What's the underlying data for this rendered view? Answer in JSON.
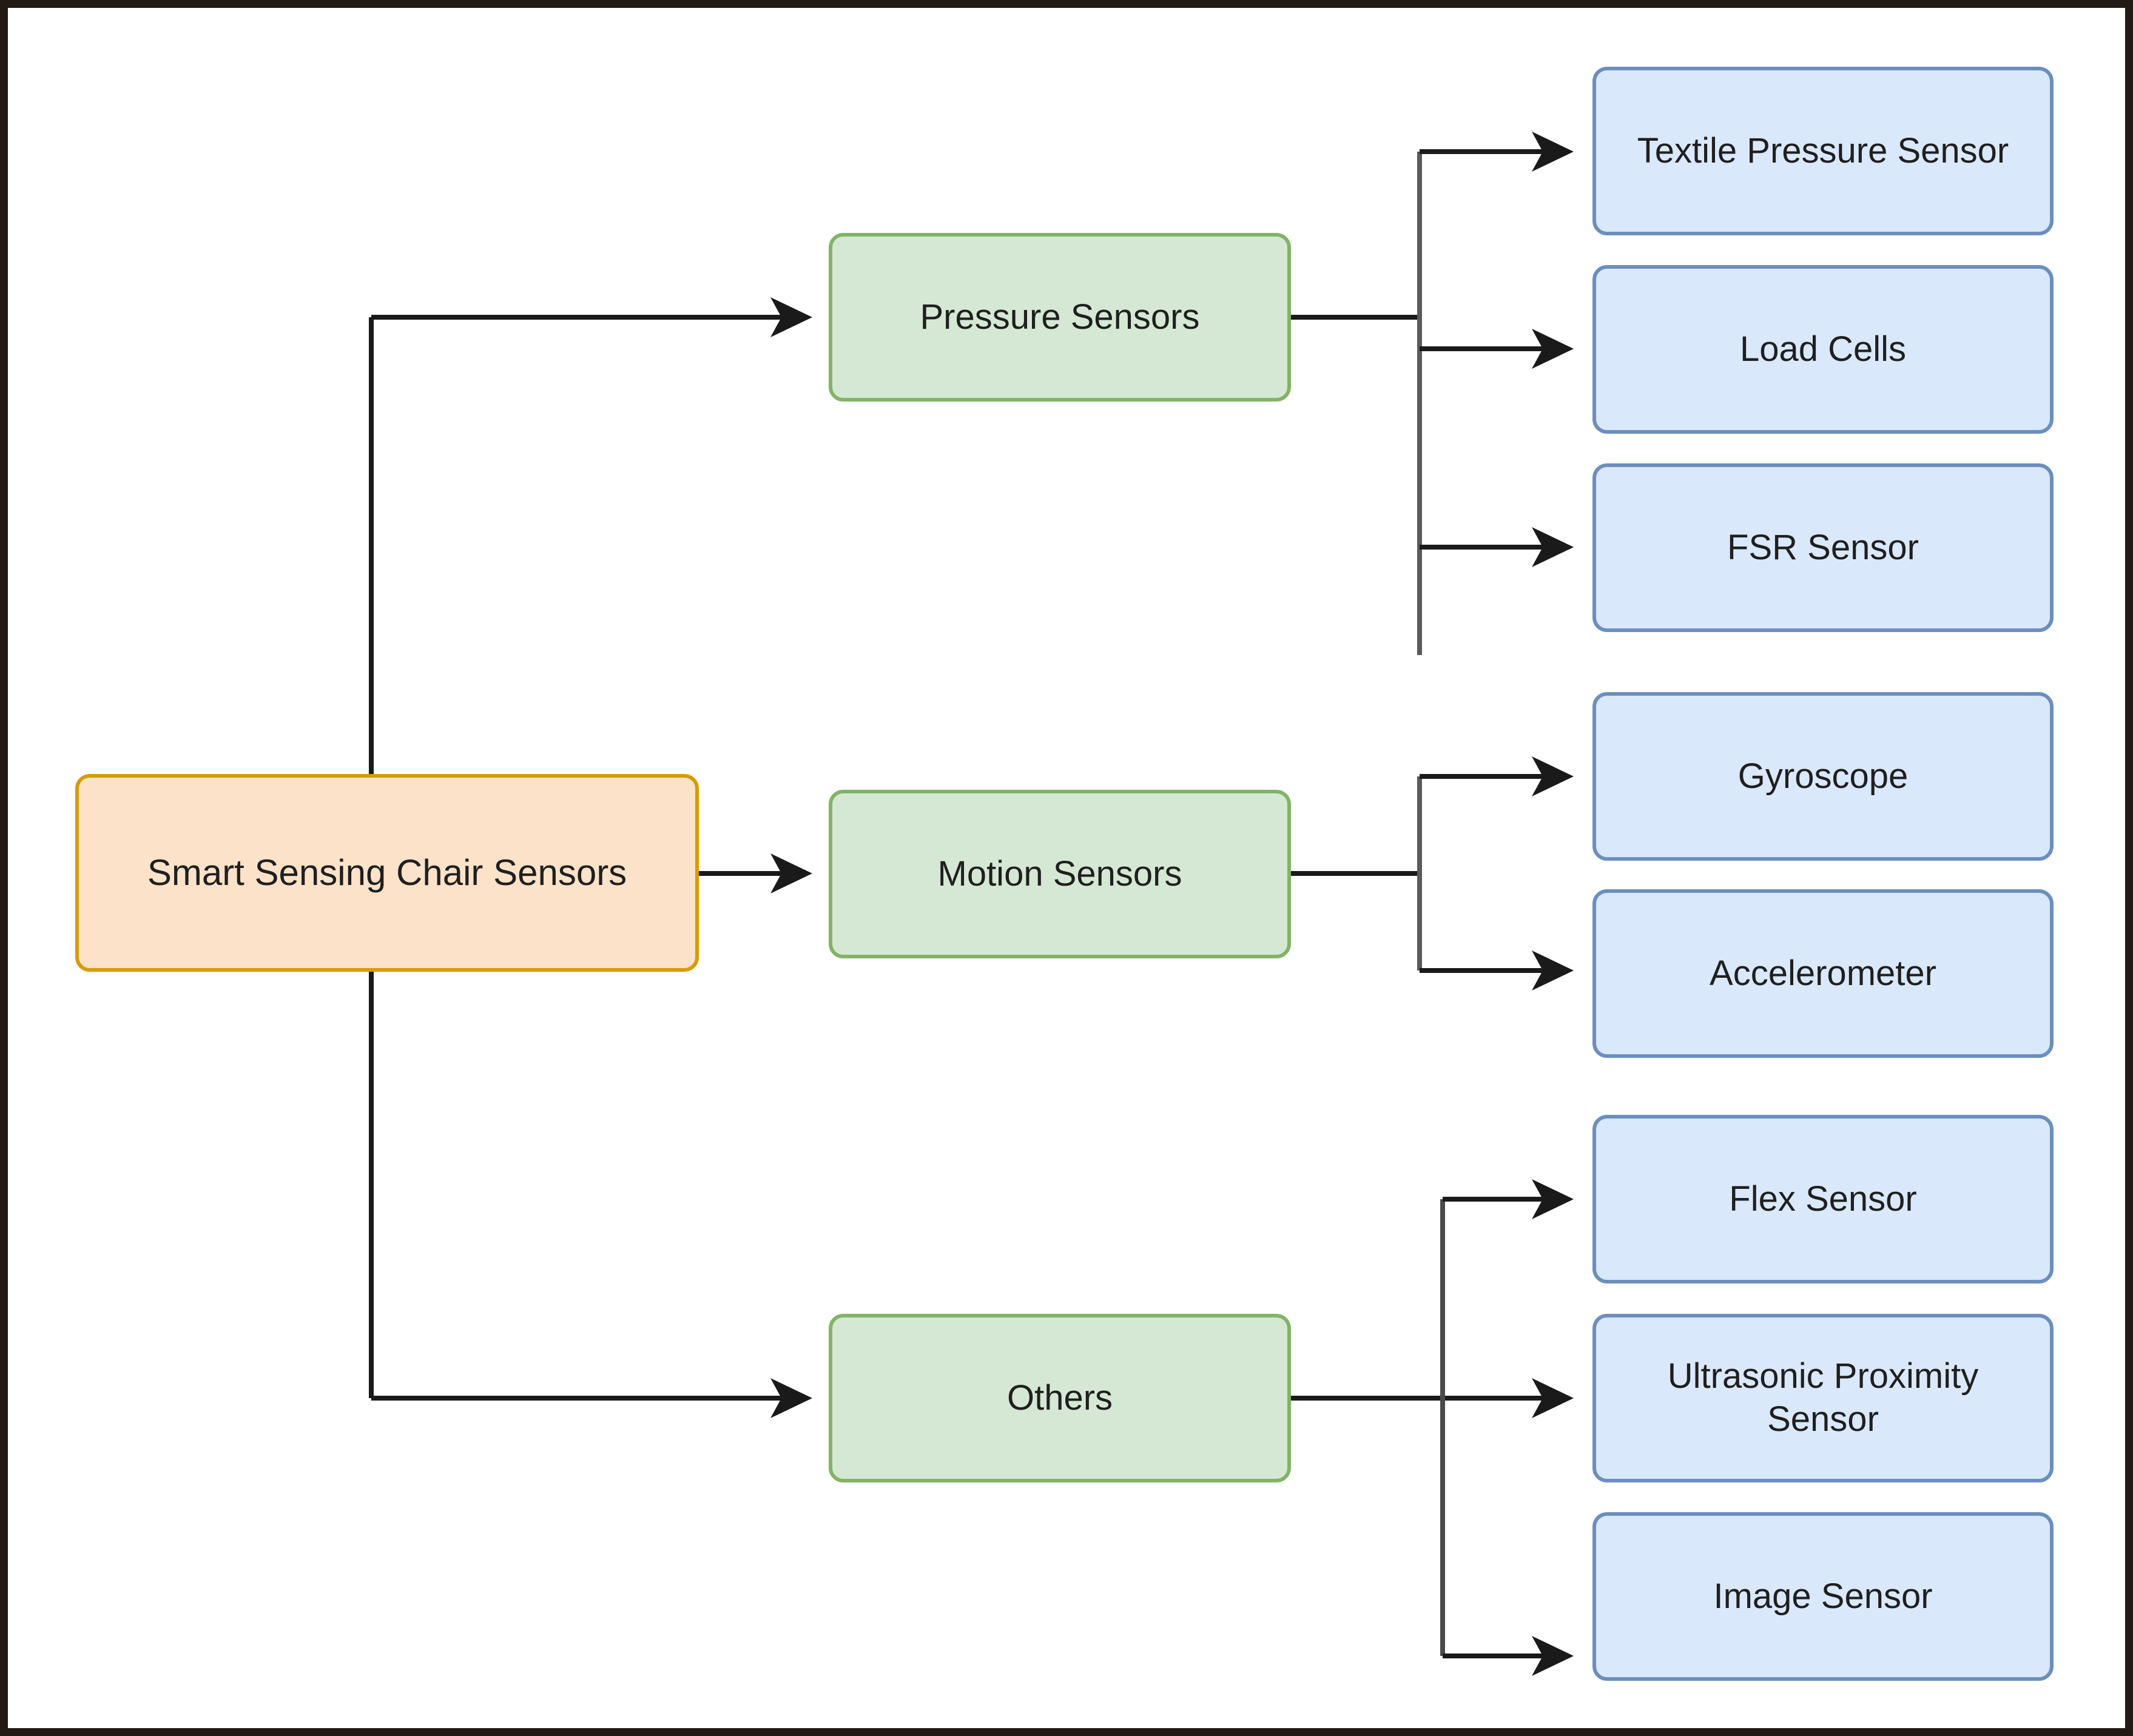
{
  "diagram": {
    "title": "Smart Sensing Chair Sensors taxonomy",
    "type": "tree",
    "orientation": "left-to-right",
    "colors": {
      "root_fill": "#fbe2c8",
      "root_stroke": "#d79b00",
      "category_fill": "#d5e8d4",
      "category_stroke": "#82b366",
      "leaf_fill": "#dae8fc",
      "leaf_stroke": "#6c8ebf",
      "edge": "#1a1a1a",
      "frame": "#231a15",
      "background": "#ffffff"
    }
  },
  "root": {
    "label": "Smart Sensing Chair Sensors"
  },
  "categories": [
    {
      "label": "Pressure Sensors",
      "children": [
        {
          "label": "Textile Pressure Sensor"
        },
        {
          "label": "Load Cells"
        },
        {
          "label": "FSR Sensor"
        }
      ]
    },
    {
      "label": "Motion Sensors",
      "children": [
        {
          "label": "Gyroscope"
        },
        {
          "label": "Accelerometer"
        }
      ]
    },
    {
      "label": "Others",
      "children": [
        {
          "label": "Flex Sensor"
        },
        {
          "label": "Ultrasonic Proximity Sensor"
        },
        {
          "label": "Image Sensor"
        }
      ]
    }
  ]
}
